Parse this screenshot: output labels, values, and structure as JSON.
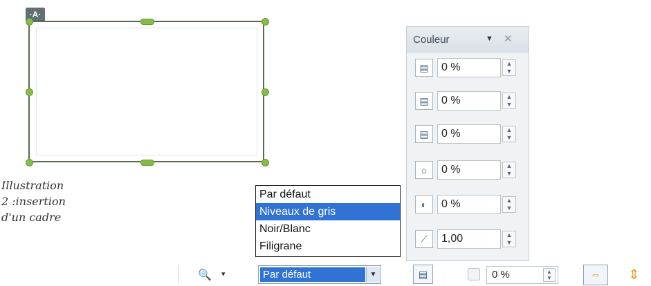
{
  "frame": {
    "badge": "·A·"
  },
  "caption": {
    "lines": [
      "Illustration",
      "2 :insertion",
      "d'un cadre"
    ]
  },
  "color_panel": {
    "title": "Couleur",
    "menu_glyph": "▼",
    "close_glyph": "✕",
    "rows": [
      {
        "icon": "red-channel-icon",
        "glyph": "▤",
        "value": "0 %"
      },
      {
        "icon": "green-channel-icon",
        "glyph": "▤",
        "value": "0 %"
      },
      {
        "icon": "blue-channel-icon",
        "glyph": "▤",
        "value": "0 %"
      },
      {
        "icon": "brightness-icon",
        "glyph": "☼",
        "value": "0 %"
      },
      {
        "icon": "contrast-icon",
        "glyph": "◐",
        "value": "0 %"
      },
      {
        "icon": "gamma-icon",
        "glyph": "⟋",
        "value": "1,00"
      }
    ]
  },
  "dropdown": {
    "options": [
      "Par défaut",
      "Niveaux de gris",
      "Noir/Blanc",
      "Filigrane"
    ],
    "highlighted": 1
  },
  "toolbar": {
    "filter_glyph": "🔍",
    "filter_arrow": "▾",
    "mode_value": "Par défaut",
    "mode_arrow": "▼",
    "crop_glyph": "▤",
    "transparency_value": "0 %",
    "flip_h_glyph": "⇔",
    "flip_v_glyph": "⇕"
  },
  "colors": {
    "accent": "#3173d4",
    "handle": "#86bb47",
    "flip": "#e09a1a"
  }
}
